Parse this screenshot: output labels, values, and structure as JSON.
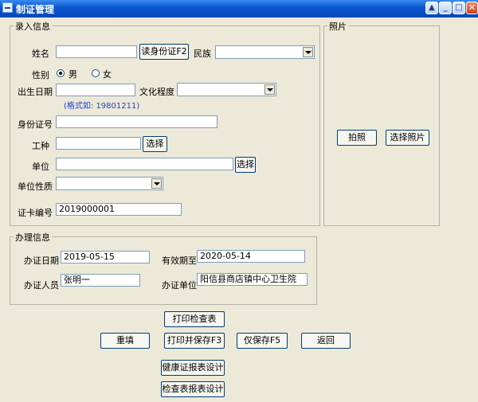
{
  "window": {
    "title": "制证管理"
  },
  "entry": {
    "group_title": "录入信息",
    "name_label": "姓名",
    "name_value": "",
    "read_id_button": "读身份证F2",
    "ethnicity_label": "民族",
    "gender_label": "性别",
    "gender_male": "男",
    "gender_female": "女",
    "gender_selected": "男",
    "birthdate_label": "出生日期",
    "birthdate_hint": "(格式如: 19801211)",
    "education_label": "文化程度",
    "id_number_label": "身份证号",
    "job_label": "工种",
    "select_button": "选择",
    "unit_label": "单位",
    "unit_type_label": "单位性质",
    "card_number_label": "证卡编号",
    "card_number_value": "2019000001"
  },
  "photo": {
    "group_title": "照片",
    "capture_button": "拍照",
    "choose_button": "选择照片"
  },
  "process": {
    "group_title": "办理信息",
    "issue_date_label": "办证日期",
    "issue_date_value": "2019-05-15",
    "valid_until_label": "有效期至",
    "valid_until_value": "2020-05-14",
    "staff_label": "办证人员",
    "staff_value": "张明一",
    "office_label": "办证单位",
    "office_value": "阳信县商店镇中心卫生院"
  },
  "actions": {
    "print_checklist": "打印检查表",
    "reset": "重填",
    "print_save": "打印并保存F3",
    "save_only": "仅保存F5",
    "back": "返回",
    "health_report_design": "健康证报表设计",
    "check_report_design": "检查表报表设计"
  }
}
